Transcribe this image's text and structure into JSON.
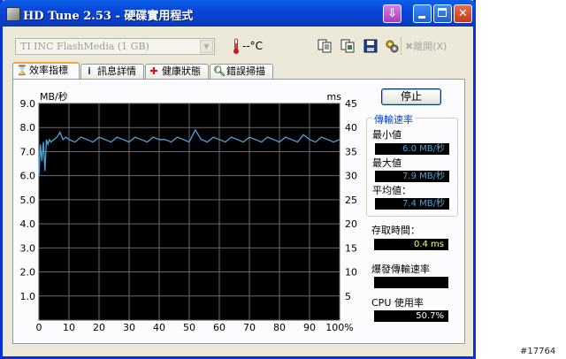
{
  "window": {
    "title": "HD Tune 2.53 - 硬碟實用程式"
  },
  "toolbar": {
    "drive": "TI INC  FlashMedia (1 GB)",
    "temperature": "--°C",
    "exit_label": "離開(X)",
    "icons": [
      "copy-text-icon",
      "copy-image-icon",
      "save-icon",
      "options-icon",
      "exit-icon"
    ]
  },
  "tabs": [
    {
      "label": "效率指標",
      "icon": "benchmark-icon",
      "active": true
    },
    {
      "label": "訊息詳情",
      "icon": "info-icon",
      "active": false
    },
    {
      "label": "健康狀態",
      "icon": "health-icon",
      "active": false
    },
    {
      "label": "錯誤掃描",
      "icon": "error-scan-icon",
      "active": false
    }
  ],
  "controls": {
    "stop_label": "停止"
  },
  "stats": {
    "group_title": "傳輸速率",
    "min_label": "最小値",
    "min_value": "6.0 MB/秒",
    "max_label": "最大値",
    "max_value": "7.9 MB/秒",
    "avg_label": "平均値：",
    "avg_value": "7.4 MB/秒",
    "access_label": "存取時間：",
    "access_value": "0.4 ms",
    "burst_label": "爆發傳輸速率",
    "burst_value": "",
    "cpu_label": "CPU 使用率",
    "cpu_value": "50.7%"
  },
  "watermark": "#17764",
  "colors": {
    "chart_bg": "#000000",
    "grid": "#6a6a6a",
    "line": "#4aa3df",
    "titlebar": "#0846d8",
    "stats_blue": "#4aa3df",
    "stats_yellow": "#ffff66"
  },
  "chart_data": {
    "type": "line",
    "ylabel": "MB/秒",
    "y2label": "ms",
    "x_ticks": [
      "0",
      "10",
      "20",
      "30",
      "40",
      "50",
      "60",
      "70",
      "80",
      "90",
      "100%"
    ],
    "y_ticks": [
      "1.0",
      "2.0",
      "3.0",
      "4.0",
      "5.0",
      "6.0",
      "7.0",
      "8.0",
      "9.0"
    ],
    "y2_ticks": [
      "5",
      "10",
      "15",
      "20",
      "25",
      "30",
      "35",
      "40",
      "45"
    ],
    "xlim": [
      0,
      100
    ],
    "ylim": [
      0,
      9
    ],
    "y2lim": [
      0,
      45
    ],
    "grid": true,
    "series": [
      {
        "x": [
          0,
          0.5,
          1,
          1.5,
          2,
          2.5,
          3,
          3.5,
          4,
          5,
          6,
          7,
          8,
          9,
          10,
          12,
          14,
          16,
          18,
          20,
          22,
          24,
          26,
          28,
          30,
          32,
          34,
          36,
          38,
          40,
          42,
          44,
          46,
          48,
          50,
          52,
          54,
          56,
          58,
          60,
          62,
          64,
          66,
          68,
          70,
          72,
          74,
          76,
          78,
          80,
          82,
          84,
          86,
          88,
          90,
          92,
          94,
          96,
          98,
          100
        ],
        "values": [
          6.0,
          7.3,
          6.6,
          7.4,
          6.2,
          7.5,
          7.3,
          7.5,
          7.4,
          7.5,
          7.6,
          7.8,
          7.5,
          7.6,
          7.5,
          7.4,
          7.6,
          7.5,
          7.4,
          7.6,
          7.5,
          7.4,
          7.6,
          7.5,
          7.4,
          7.6,
          7.5,
          7.4,
          7.6,
          7.5,
          7.5,
          7.4,
          7.6,
          7.5,
          7.4,
          7.9,
          7.5,
          7.4,
          7.6,
          7.5,
          7.4,
          7.6,
          7.5,
          7.4,
          7.6,
          7.5,
          7.4,
          7.6,
          7.5,
          7.4,
          7.6,
          7.5,
          7.4,
          7.7,
          7.5,
          7.4,
          7.6,
          7.5,
          7.4,
          7.5
        ]
      }
    ]
  }
}
